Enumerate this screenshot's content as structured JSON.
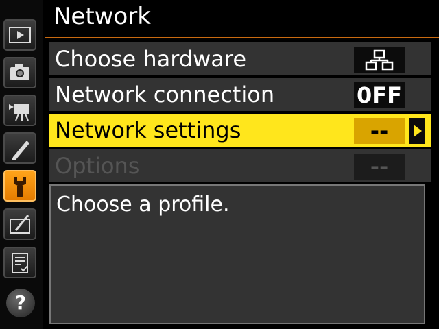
{
  "title": "Network",
  "menu": [
    {
      "label": "Choose hardware",
      "value": "",
      "value_icon": "wired-lan-icon",
      "state": "normal"
    },
    {
      "label": "Network connection",
      "value": "0FF",
      "state": "normal"
    },
    {
      "label": "Network settings",
      "value": "--",
      "state": "selected"
    },
    {
      "label": "Options",
      "value": "--",
      "state": "disabled"
    }
  ],
  "help": {
    "text": "Choose a profile."
  },
  "rail": {
    "tabs": [
      "playback-icon",
      "camera-icon",
      "movie-icon",
      "pencil-icon",
      "wrench-icon",
      "retouch-icon",
      "my-menu-icon"
    ],
    "active": "wrench-icon",
    "help_label": "?"
  },
  "colors": {
    "accent": "#ffe61c",
    "tab_active": "#f08c00",
    "title_line": "#c96a10"
  }
}
